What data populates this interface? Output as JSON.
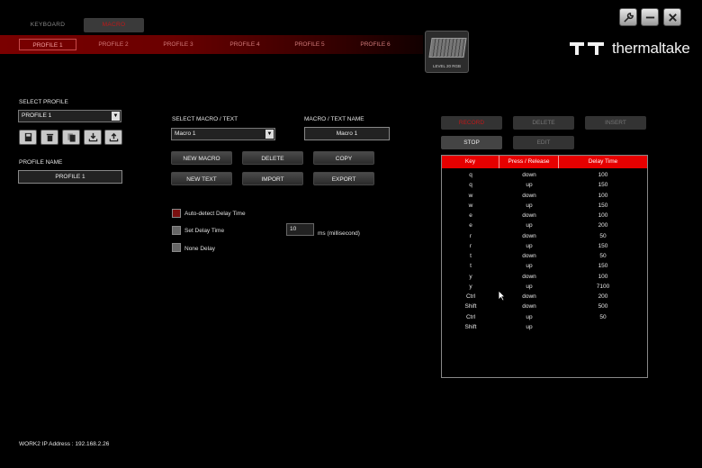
{
  "top_tabs": {
    "keyboard": "KEYBOARD",
    "macro": "MACRO"
  },
  "profile_tabs": [
    "PROFILE 1",
    "PROFILE 2",
    "PROFILE 3",
    "PROFILE 4",
    "PROFILE 5",
    "PROFILE 6"
  ],
  "device": {
    "label": "LEVEL 20 RGB"
  },
  "brand": {
    "name": "thermaltake"
  },
  "left": {
    "select_profile_label": "SELECT PROFILE",
    "select_profile_value": "PROFILE 1",
    "profile_name_label": "PROFILE NAME",
    "profile_name_value": "PROFILE 1"
  },
  "macro": {
    "select_label": "SELECT MACRO / TEXT",
    "select_value": "Macro 1",
    "name_label": "MACRO / TEXT NAME",
    "name_value": "Macro 1",
    "buttons": {
      "new_macro": "NEW MACRO",
      "delete": "DELETE",
      "copy": "COPY",
      "new_text": "NEW TEXT",
      "import": "IMPORT",
      "export": "EXPORT"
    },
    "options": {
      "auto_detect": "Auto-detect Delay Time",
      "set_delay": "Set Delay Time",
      "delay_value": "10",
      "delay_unit": "ms (millisecond)",
      "none_delay": "None Delay"
    }
  },
  "record": {
    "record": "RECORD",
    "delete": "DELETE",
    "insert": "INSERT",
    "stop": "STOP",
    "edit": "EDIT",
    "headers": [
      "Key",
      "Press / Release",
      "Delay Time"
    ],
    "rows": [
      [
        "q",
        "down",
        "100"
      ],
      [
        "q",
        "up",
        "150"
      ],
      [
        "w",
        "down",
        "100"
      ],
      [
        "w",
        "up",
        "150"
      ],
      [
        "e",
        "down",
        "100"
      ],
      [
        "e",
        "up",
        "200"
      ],
      [
        "r",
        "down",
        "50"
      ],
      [
        "r",
        "up",
        "150"
      ],
      [
        "t",
        "down",
        "50"
      ],
      [
        "t",
        "up",
        "150"
      ],
      [
        "y",
        "down",
        "100"
      ],
      [
        "y",
        "up",
        "7100"
      ],
      [
        "Ctrl",
        "down",
        "200"
      ],
      [
        "Shift",
        "down",
        "500"
      ],
      [
        "Ctrl",
        "up",
        "50"
      ],
      [
        "Shift",
        "up",
        ""
      ]
    ]
  },
  "status": {
    "ip": "WORK2 IP Address : 192.168.2.26"
  },
  "colors": {
    "accent": "#e60000",
    "strip": "#7a0000"
  }
}
